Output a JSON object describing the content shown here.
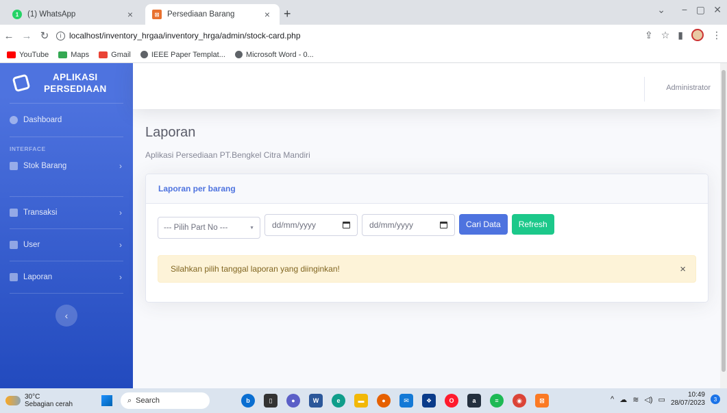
{
  "browser": {
    "tabs": [
      {
        "title": "(1) WhatsApp",
        "favicon_color": "#25d366"
      },
      {
        "title": "Persediaan Barang",
        "favicon_color": "#e8712f"
      }
    ],
    "url": "localhost/inventory_hrgaa/inventory_hrga/admin/stock-card.php",
    "bookmarks": [
      {
        "label": "YouTube",
        "color": "#ff0000"
      },
      {
        "label": "Maps",
        "color": "#34a853"
      },
      {
        "label": "Gmail",
        "color": "#ea4335"
      },
      {
        "label": "IEEE Paper Templat...",
        "color": "#5f6368"
      },
      {
        "label": "Microsoft Word - 0...",
        "color": "#5f6368"
      }
    ]
  },
  "sidebar": {
    "brand_line1": "APLIKASI",
    "brand_line2": "PERSEDIAAN",
    "dashboard": "Dashboard",
    "heading": "INTERFACE",
    "items": [
      {
        "label": "Stok Barang",
        "icon": "wrench-icon"
      },
      {
        "label": "Transaksi",
        "icon": "transaction-icon"
      },
      {
        "label": "User",
        "icon": "users-icon"
      },
      {
        "label": "Laporan",
        "icon": "list-icon"
      }
    ],
    "toggle": "‹"
  },
  "topbar": {
    "user_name": "Administrator"
  },
  "page": {
    "title": "Laporan",
    "subtitle": "Aplikasi Persediaan PT.Bengkel Citra Mandiri"
  },
  "card": {
    "header": "Laporan per barang",
    "part_select": "--- Pilih Part No ---",
    "date_from_placeholder": "dd/mm/yyyy",
    "date_to_placeholder": "dd/mm/yyyy",
    "search_button": "Cari Data",
    "refresh_button": "Refresh",
    "alert": "Silahkan pilih tanggal laporan yang diinginkan!",
    "alert_close": "×"
  },
  "taskbar": {
    "temperature": "30°C",
    "weather": "Sebagian cerah",
    "search": "Search",
    "time": "10:49",
    "date": "28/07/2023",
    "notifications": "3"
  },
  "colors": {
    "primary": "#4e73df",
    "success": "#1cc88a",
    "warning_bg": "#fdf3d8"
  }
}
